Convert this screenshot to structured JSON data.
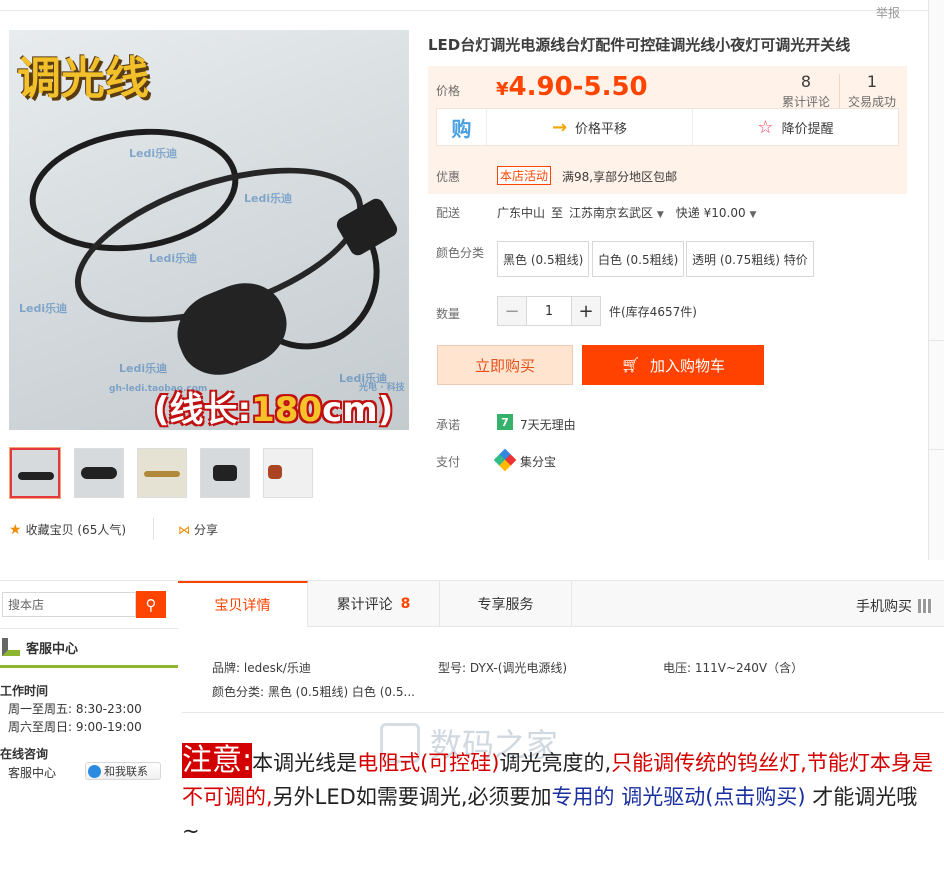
{
  "top": {
    "report_label": "举报"
  },
  "gallery": {
    "title_overlay": "调光线",
    "length_prefix": "(线长:",
    "length_value": "180",
    "length_suffix": "cm)",
    "watermark_brand": "Ledi乐迪",
    "watermark_url": "gh-ledi.taobao.com",
    "watermark_slogan": "光电 · 科技"
  },
  "social": {
    "favorite_label": "收藏宝贝 (65人气)",
    "share_label": "分享"
  },
  "product": {
    "title": "LED台灯调光电源线台灯配件可控硅调光线小夜灯可调光开关线",
    "price_label": "价格",
    "currency": "¥",
    "price": "4.90-5.50",
    "reviews_count": "8",
    "reviews_label": "累计评论",
    "sales_count": "1",
    "sales_label": "交易成功",
    "promo_icon": "购",
    "price_trend": "价格平移",
    "price_alert": "降价提醒",
    "discount_label": "优惠",
    "discount_tag": "本店活动",
    "discount_text": "满98,享部分地区包邮",
    "shipping_label": "配送",
    "ship_from": "广东中山",
    "ship_to_word": "至",
    "ship_to": "江苏南京玄武区",
    "ship_method": "快递 ¥10.00",
    "color_label": "颜色分类",
    "color_options": [
      "黑色 (0.5粗线)",
      "白色 (0.5粗线)",
      "透明 (0.75粗线) 特价"
    ],
    "qty_label": "数量",
    "qty_value": "1",
    "qty_minus": "−",
    "qty_plus": "+",
    "stock_text": "件(库存4657件)",
    "buy_now": "立即购买",
    "add_cart": "加入购物车",
    "promise_label": "承诺",
    "promise_badge": "7",
    "promise_text": "7天无理由",
    "pay_label": "支付",
    "pay_text": "集分宝"
  },
  "sidebar": {
    "search_placeholder": "搜本店",
    "service_center": "客服中心",
    "work_time_label": "工作时间",
    "weekday_hours": "周一至周五: 8:30-23:00",
    "weekend_hours": "周六至周日: 9:00-19:00",
    "online_label": "在线咨询",
    "service_agent": "客服中心",
    "contact_button": "和我联系"
  },
  "tabs": {
    "details": "宝贝详情",
    "reviews": "累计评论",
    "reviews_count": "8",
    "service": "专享服务",
    "mobile": "手机购买"
  },
  "attributes": {
    "brand": "品牌: ledesk/乐迪",
    "model": "型号: DYX-(调光电源线)",
    "voltage": "电压: 111V~240V（含）",
    "color": "颜色分类: 黑色 (0.5粗线) 白色 (0.5..."
  },
  "watermark": {
    "text": "数码之家"
  },
  "description": {
    "note": "注意:",
    "t1": "本调光线是",
    "t2": "电阻式(可控硅)",
    "t3": "调光亮度的,",
    "t4": "只能调传统的钨丝灯,节能灯本身是不可调的,",
    "t5": "另外LED如需要调光,必须要加",
    "t6": "专用的 调光驱动(点击购买)",
    "t7": " 才能调光哦~"
  },
  "colors": {
    "accent": "#ff4400",
    "green": "#8db630",
    "price_bg": "#fff2e8"
  }
}
